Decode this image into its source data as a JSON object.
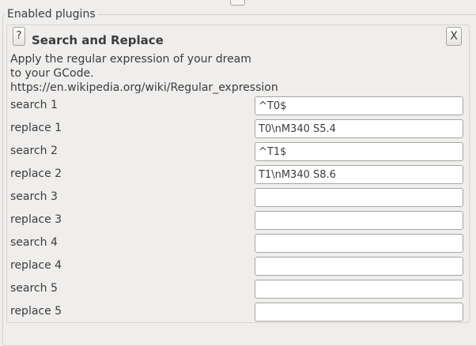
{
  "group": {
    "title": "Enabled plugins"
  },
  "plugin": {
    "help_label": "?",
    "title": "Search and Replace",
    "close_label": "X",
    "description_lines": [
      "Apply the regular expression of your dream",
      "to your GCode.",
      "https://en.wikipedia.org/wiki/Regular_expression"
    ]
  },
  "fields": [
    {
      "label": "search 1",
      "value": "^T0$"
    },
    {
      "label": "replace 1",
      "value": "T0\\nM340 S5.4"
    },
    {
      "label": "search 2",
      "value": "^T1$"
    },
    {
      "label": "replace 2",
      "value": "T1\\nM340 S8.6"
    },
    {
      "label": "search 3",
      "value": ""
    },
    {
      "label": "replace 3",
      "value": ""
    },
    {
      "label": "search 4",
      "value": ""
    },
    {
      "label": "replace 4",
      "value": ""
    },
    {
      "label": "search 5",
      "value": ""
    },
    {
      "label": "replace 5",
      "value": ""
    }
  ]
}
